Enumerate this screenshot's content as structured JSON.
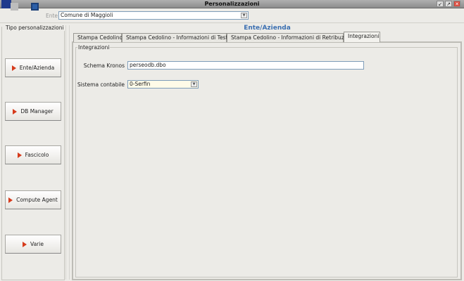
{
  "window": {
    "title": "Personalizzazioni"
  },
  "toolbar": {
    "ente_label": "Ente",
    "ente_value": "Comune di Maggioli"
  },
  "sidebar": {
    "legend": "Tipo personalizzazioni",
    "items": [
      {
        "label": "Ente/Azienda"
      },
      {
        "label": "DB Manager"
      },
      {
        "label": "Fascicolo"
      },
      {
        "label": "Compute Agent"
      },
      {
        "label": "Varie"
      }
    ]
  },
  "main": {
    "section_title": "Ente/Azienda",
    "tabs": [
      {
        "label": "Stampa Cedolino"
      },
      {
        "label": "Stampa Cedolino - Informazioni di Testata"
      },
      {
        "label": "Stampa Cedolino - Informazioni di Retribuzione"
      },
      {
        "label": "Integrazioni",
        "active": true
      }
    ],
    "group_title": "Integrazioni",
    "schema_kronos_label": "Schema Kronos",
    "schema_kronos_value": "perseodb.dbo",
    "sistema_contabile_label": "Sistema contabile",
    "sistema_contabile_value": "0-Serfin"
  },
  "colors": {
    "accent": "#3b6fb1",
    "arrow": "#d63b1c"
  }
}
